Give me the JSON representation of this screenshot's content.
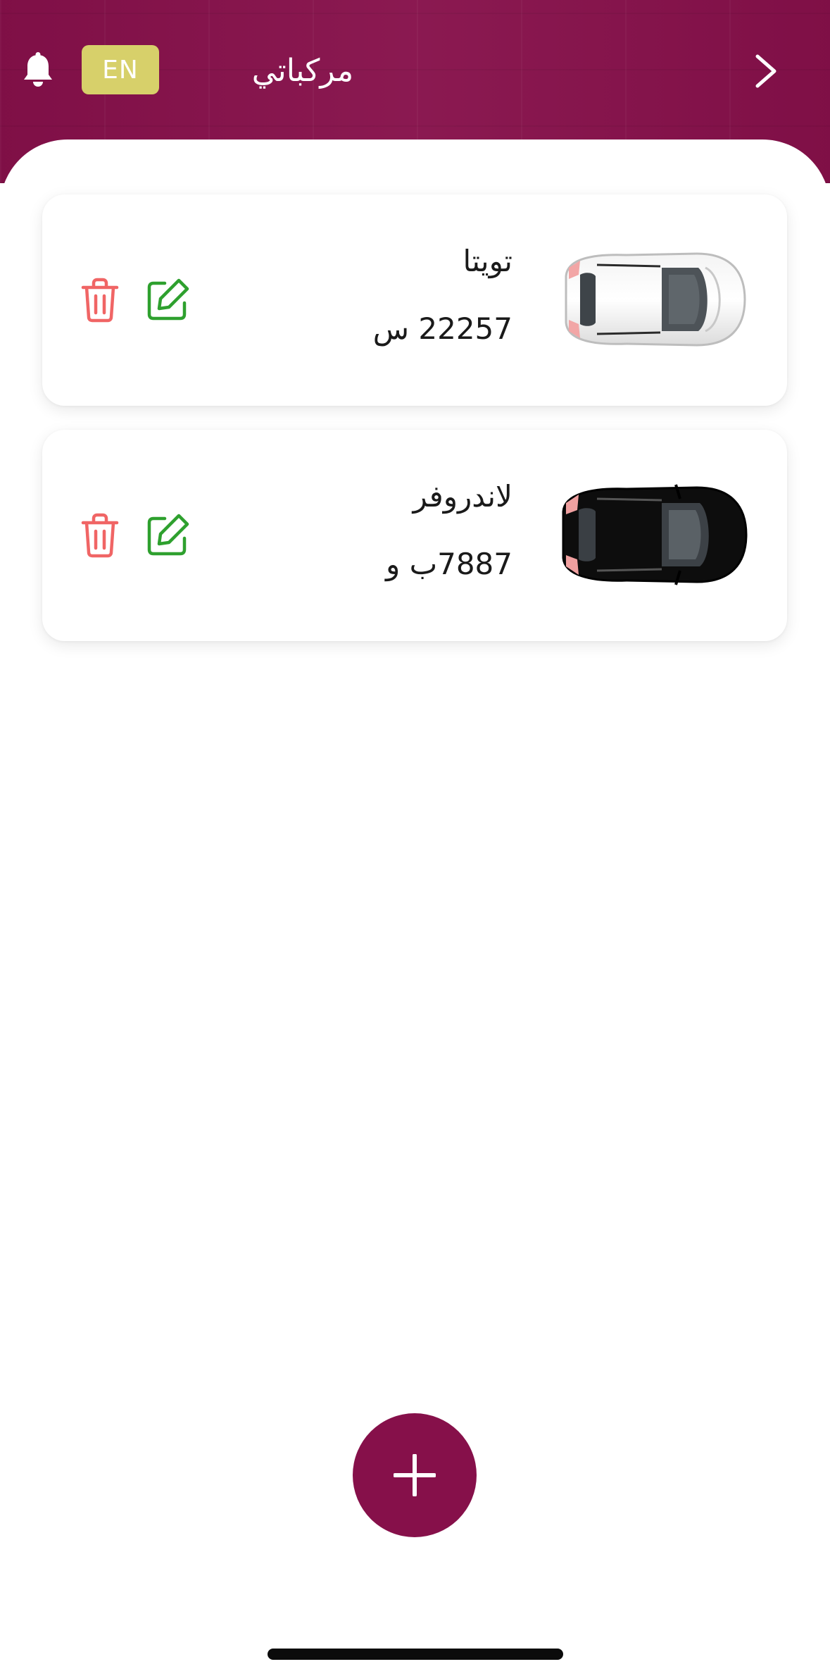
{
  "header": {
    "title": "مركباتي",
    "language_button": "EN",
    "icons": {
      "notifications": "bell-icon",
      "back": "chevron-right-icon"
    },
    "background_color": "#86104a"
  },
  "vehicles": [
    {
      "name": "تويتا",
      "plate": "22257 س",
      "car_color": "white",
      "edit_icon": "edit-icon",
      "delete_icon": "trash-icon"
    },
    {
      "name": "لاندروفر",
      "plate": "7887ب و",
      "car_color": "black",
      "edit_icon": "edit-icon",
      "delete_icon": "trash-icon"
    }
  ],
  "add_button": {
    "icon": "plus-icon",
    "color": "#86104a"
  },
  "colors": {
    "accent": "#86104a",
    "language_button": "#d7d06a",
    "delete": "#f06565",
    "edit": "#2ea02e"
  }
}
